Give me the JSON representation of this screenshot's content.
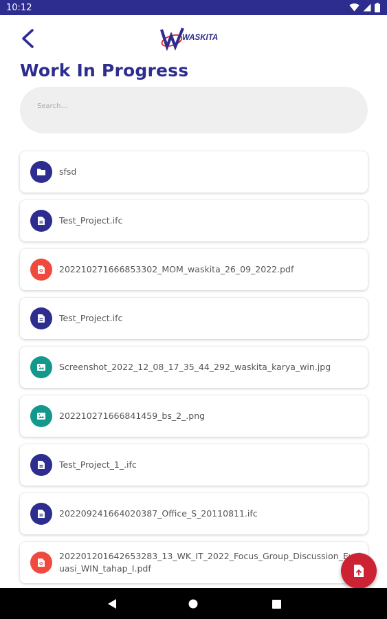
{
  "status_bar": {
    "time": "10:12",
    "icons": [
      "wifi-icon",
      "signal-icon",
      "battery-icon"
    ]
  },
  "header": {
    "logo_text": "WASKITA",
    "title": "Work In Progress"
  },
  "search": {
    "placeholder": "Search..."
  },
  "files": [
    {
      "name": "sfsd",
      "type": "folder",
      "icon": "folder-icon",
      "color": "#2d2d8f"
    },
    {
      "name": "Test_Project.ifc",
      "type": "document",
      "icon": "document-icon",
      "color": "#2d2d8f"
    },
    {
      "name": "202210271666853302_MOM_waskita_26_09_2022.pdf",
      "type": "pdf",
      "icon": "pdf-icon",
      "color": "#f04a3e"
    },
    {
      "name": "Test_Project.ifc",
      "type": "document",
      "icon": "document-icon",
      "color": "#2d2d8f"
    },
    {
      "name": "Screenshot_2022_12_08_17_35_44_292_waskita_karya_win.jpg",
      "type": "image",
      "icon": "image-icon",
      "color": "#12998c"
    },
    {
      "name": "202210271666841459_bs_2_.png",
      "type": "image",
      "icon": "image-icon",
      "color": "#12998c"
    },
    {
      "name": "Test_Project_1_.ifc",
      "type": "document",
      "icon": "document-icon",
      "color": "#2d2d8f"
    },
    {
      "name": "202209241664020387_Office_S_20110811.ifc",
      "type": "document",
      "icon": "document-icon",
      "color": "#2d2d8f"
    },
    {
      "name": "202201201642653283_13_WK_IT_2022_Focus_Group_Discussion_Evaluasi_WIN_tahap_I.pdf",
      "type": "pdf",
      "icon": "pdf-icon",
      "color": "#f04a3e"
    }
  ],
  "fab": {
    "icon": "file-upload-icon",
    "color": "#cc2233"
  },
  "colors": {
    "primary": "#2d2d8f",
    "pdf": "#f04a3e",
    "image": "#12998c",
    "fab": "#cc2233"
  },
  "nav": {
    "icons": [
      "back-triangle-icon",
      "home-circle-icon",
      "recents-square-icon"
    ]
  }
}
